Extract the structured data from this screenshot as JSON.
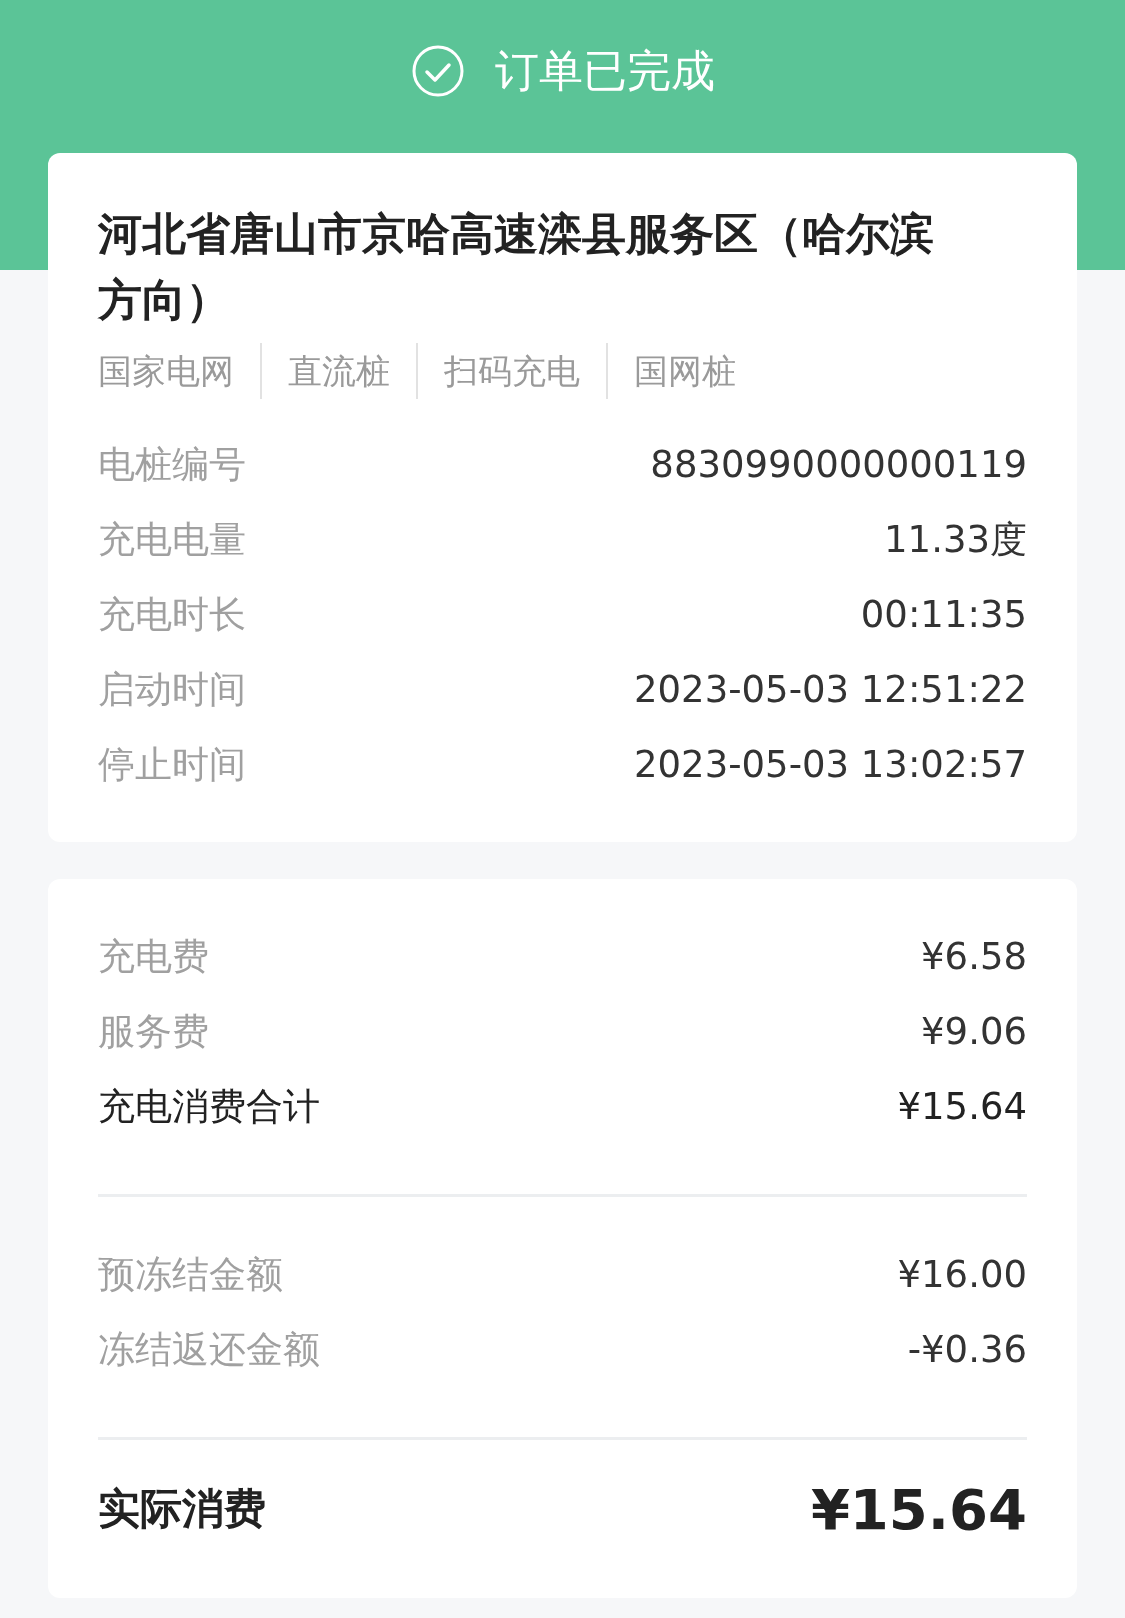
{
  "header": {
    "title": "订单已完成"
  },
  "station": {
    "name": "河北省唐山市京哈高速滦县服务区（哈尔滨方向）",
    "tags": [
      "国家电网",
      "直流桩",
      "扫码充电",
      "国网桩"
    ],
    "details": [
      {
        "label": "电桩编号",
        "value": "8830990000000119"
      },
      {
        "label": "充电电量",
        "value": "11.33度"
      },
      {
        "label": "充电时长",
        "value": "00:11:35"
      },
      {
        "label": "启动时间",
        "value": "2023-05-03 12:51:22"
      },
      {
        "label": "停止时间",
        "value": "2023-05-03 13:02:57"
      }
    ]
  },
  "fees": {
    "groups": [
      [
        {
          "label": "充电费",
          "value": "¥6.58",
          "kind": "item"
        },
        {
          "label": "服务费",
          "value": "¥9.06",
          "kind": "item"
        },
        {
          "label": "充电消费合计",
          "value": "¥15.64",
          "kind": "subtotal"
        }
      ],
      [
        {
          "label": "预冻结金额",
          "value": "¥16.00",
          "kind": "item"
        },
        {
          "label": "冻结返还金额",
          "value": "-¥0.36",
          "kind": "item"
        }
      ]
    ],
    "total": {
      "label": "实际消费",
      "value": "¥15.64"
    }
  }
}
